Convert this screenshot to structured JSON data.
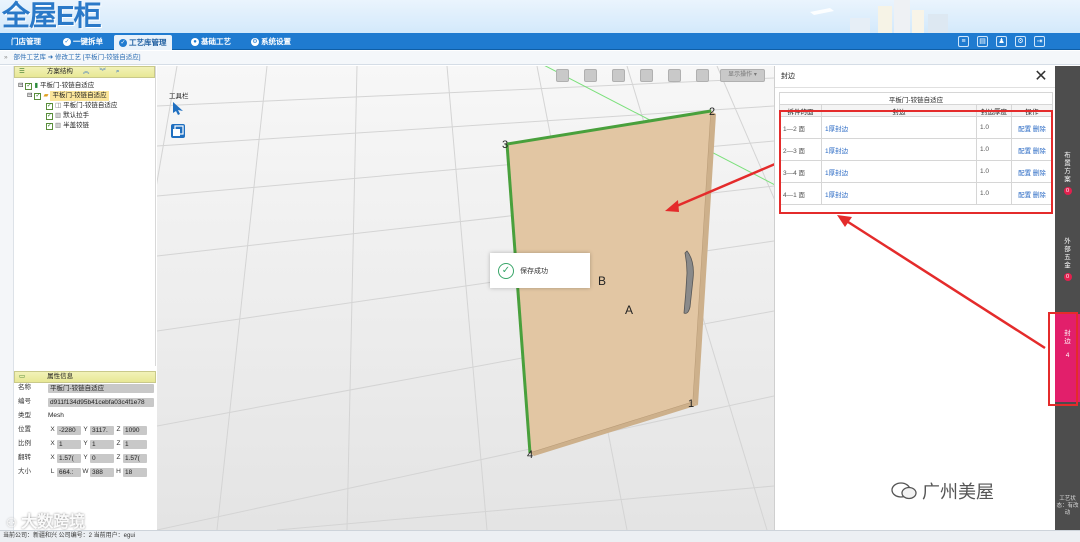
{
  "app": {
    "logo": "全屋E柜"
  },
  "nav": {
    "items": [
      {
        "label": "门店管理",
        "icon": "store-icon"
      },
      {
        "label": "一键拆单",
        "icon": "check-circle-icon"
      },
      {
        "label": "工艺库管理",
        "icon": "check-circle-icon",
        "active": true
      },
      {
        "label": "基础工艺",
        "icon": "circle-icon"
      },
      {
        "label": "系统设置",
        "icon": "gear-icon"
      }
    ]
  },
  "breadcrumb": {
    "text": "部件工艺库 ➜ 修改工艺 [平板门-铰链自适应]"
  },
  "tree": {
    "header": "方案结构",
    "nodes": [
      {
        "label": "平板门-铰链自适应",
        "level": 0
      },
      {
        "label": "平板门-铰链自适应",
        "level": 1,
        "selected": true
      },
      {
        "label": "平板门-铰链自适应",
        "level": 2
      },
      {
        "label": "默认拉手",
        "level": 2
      },
      {
        "label": "半盖铰链",
        "level": 2
      }
    ]
  },
  "attributes": {
    "header": "属性信息",
    "name_label": "名称",
    "name": "平板门-铰链自适应",
    "id_label": "编号",
    "id": "d911f134d95b41cebfa03c4f1e78",
    "type_label": "类型",
    "type": "Mesh",
    "position_label": "位置",
    "position": {
      "x": "-2280",
      "y": "3117.",
      "z": "1090"
    },
    "scale_label": "比例",
    "scale": {
      "x": "1",
      "y": "1",
      "z": "1"
    },
    "rotation_label": "翻转",
    "rotation": {
      "x": "1.57(",
      "y": "0",
      "z": "1.57("
    },
    "size_label": "大小",
    "size": {
      "l": "664.:",
      "w": "388",
      "h": "18"
    }
  },
  "viewport": {
    "toolbox_title": "工具栏",
    "view_ops": "显示操作",
    "vertex_labels": [
      "1",
      "2",
      "3",
      "4"
    ],
    "face_labels": [
      "A",
      "B"
    ],
    "toast": "保存成功"
  },
  "dialog": {
    "title": "封边",
    "table_caption": "平板门-铰链自适应",
    "headers": [
      "拆件的面",
      "封边",
      "封边厚度",
      "操作"
    ],
    "rows": [
      {
        "face": "1—2 面",
        "band": "1厚封边",
        "thickness": "1.0",
        "ops": "配置 删除"
      },
      {
        "face": "2—3 面",
        "band": "1厚封边",
        "thickness": "1.0",
        "ops": "配置 删除"
      },
      {
        "face": "3—4 面",
        "band": "1厚封边",
        "thickness": "1.0",
        "ops": "配置 删除"
      },
      {
        "face": "4—1 面",
        "band": "1厚封边",
        "thickness": "1.0",
        "ops": "配置 删除"
      }
    ]
  },
  "right_bar": {
    "tabs": [
      {
        "label": "布置方案",
        "count": "0"
      },
      {
        "label": "外部五金",
        "count": "0"
      },
      {
        "label": "封边",
        "count": "4",
        "active": true
      }
    ],
    "footer": "工艺状态：有改动"
  },
  "status": {
    "text": "当前公司：新疆和兴   公司编号：2   当前用户：egui"
  },
  "watermarks": {
    "left": "大数跨境",
    "right": "广州美屋"
  },
  "colors": {
    "accent": "#1f7bd0",
    "panel": "#e2c6a3",
    "edge_band": "#49a03c",
    "highlight": "#e42b2b",
    "badge": "#e2204e"
  }
}
